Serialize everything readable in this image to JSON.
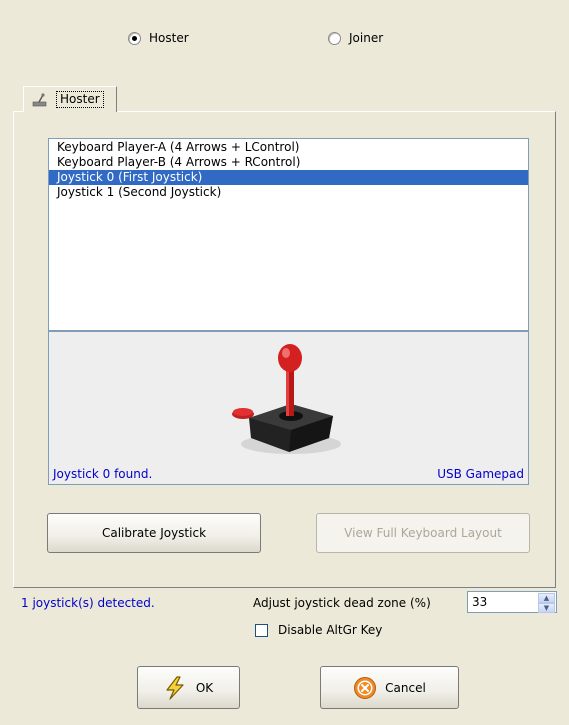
{
  "mode": {
    "hoster_label": "Hoster",
    "joiner_label": "Joiner",
    "selected": "Hoster"
  },
  "tab": {
    "label": "Hoster"
  },
  "devices": {
    "items": [
      "Keyboard Player-A (4 Arrows + LControl)",
      "Keyboard Player-B (4 Arrows + RControl)",
      "Joystick 0 (First Joystick)",
      "Joystick 1 (Second Joystick)"
    ],
    "selected_index": 2
  },
  "preview": {
    "found_text": "Joystick 0 found.",
    "device_type": "USB Gamepad"
  },
  "buttons": {
    "calibrate": "Calibrate Joystick",
    "keyboard_layout": "View Full Keyboard Layout",
    "ok": "OK",
    "cancel": "Cancel"
  },
  "status": {
    "detected": "1 joystick(s) detected."
  },
  "deadzone": {
    "label": "Adjust joystick dead zone (%)",
    "value": "33"
  },
  "altgr": {
    "label": "Disable AltGr Key",
    "checked": false
  },
  "colors": {
    "dialog_bg": "#ece9d8",
    "selection": "#316ac5",
    "info_text": "#0000cc"
  }
}
